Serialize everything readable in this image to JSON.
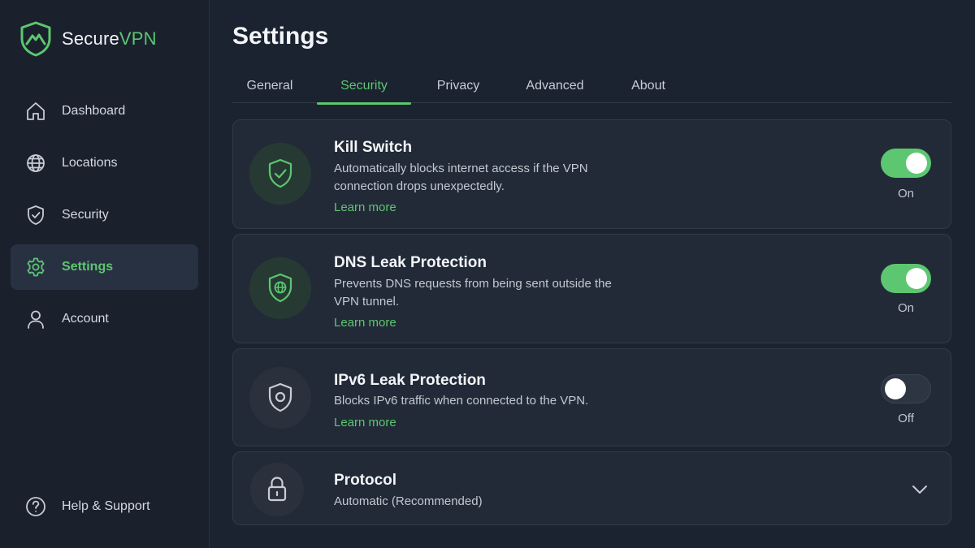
{
  "brand": {
    "name_prefix": "Secure",
    "name_accent": "VPN"
  },
  "sidebar": {
    "items": [
      {
        "label": "Dashboard",
        "icon": "home-icon"
      },
      {
        "label": "Locations",
        "icon": "globe-icon"
      },
      {
        "label": "Security",
        "icon": "shield-icon"
      },
      {
        "label": "Settings",
        "icon": "gear-icon",
        "active": true
      },
      {
        "label": "Account",
        "icon": "user-icon"
      }
    ],
    "help": {
      "label": "Help & Support",
      "icon": "help-icon"
    }
  },
  "page": {
    "title": "Settings",
    "tabs": [
      {
        "label": "General"
      },
      {
        "label": "Security",
        "active": true
      },
      {
        "label": "Privacy"
      },
      {
        "label": "Advanced"
      },
      {
        "label": "About"
      }
    ]
  },
  "settings": [
    {
      "title": "Kill Switch",
      "description": "Automatically blocks internet access if the VPN connection drops unexpectedly.",
      "link": "Learn more",
      "enabled": true,
      "state_label": "On",
      "icon": "shield-check-icon"
    },
    {
      "title": "DNS Leak Protection",
      "description": "Prevents DNS requests from being sent outside the VPN tunnel.",
      "link": "Learn more",
      "enabled": true,
      "state_label": "On",
      "icon": "shield-globe-icon"
    },
    {
      "title": "IPv6 Leak Protection",
      "description": "Blocks IPv6 traffic when connected to the VPN.",
      "link": "Learn more",
      "enabled": false,
      "state_label": "Off",
      "icon": "shield-circle-icon"
    }
  ],
  "protocol": {
    "title": "Protocol",
    "value": "Automatic (Recommended)",
    "icon": "lock-icon"
  },
  "colors": {
    "accent": "#5cc770",
    "background": "#1b2230",
    "card": "#222a37"
  }
}
